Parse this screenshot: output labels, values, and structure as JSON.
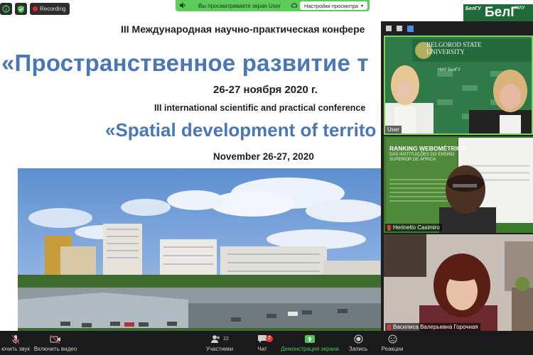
{
  "status": {
    "recording_label": "Recording"
  },
  "share_banner": {
    "text": "Вы просматриваете экран User",
    "view_options_label": "Настройки просмотра"
  },
  "slide": {
    "title_ru_conf": "III Международная научно-практическая конфере",
    "title_ru_main": "«Пространственное развитие т",
    "dates_ru": "26-27 ноября 2020 г.",
    "title_en_conf": "III international scientific and practical conference",
    "title_en_main": "«Spatial development of territo",
    "dates_en": "November 26-27, 2020"
  },
  "logo": {
    "small_text": "БелГУ",
    "big_text": "БелГ",
    "niu": "НИУ"
  },
  "participants_tiles": [
    {
      "name": "User",
      "banner": "BELGOROD STATE UNIVERSITY",
      "banner_sub": "НИУ БелГУ",
      "active": true
    },
    {
      "name": "Herinelto Casimiro",
      "slide_text_1": "RANKING WEBOMÉTRICO",
      "slide_text_2": "DAS INSTITUIÇÕES DO ENSINO SUPERIOR DE ÁFRICA",
      "muted": true
    },
    {
      "name": "Василиса Валерьевна Горочная",
      "muted": true
    }
  ],
  "toolbar": {
    "mute_label": "ючить звук",
    "video_label": "Включить видео",
    "participants_label": "Участники",
    "participants_count": "22",
    "chat_label": "Чат",
    "chat_badge": "2",
    "share_label": "Демонстрация экрана",
    "record_label": "Запись",
    "reactions_label": "Реакции"
  },
  "colors": {
    "accent_green": "#5dcc5a",
    "slide_blue": "#4a77b8",
    "active_speaker": "#7cd35d",
    "chat_badge": "#e53935"
  }
}
